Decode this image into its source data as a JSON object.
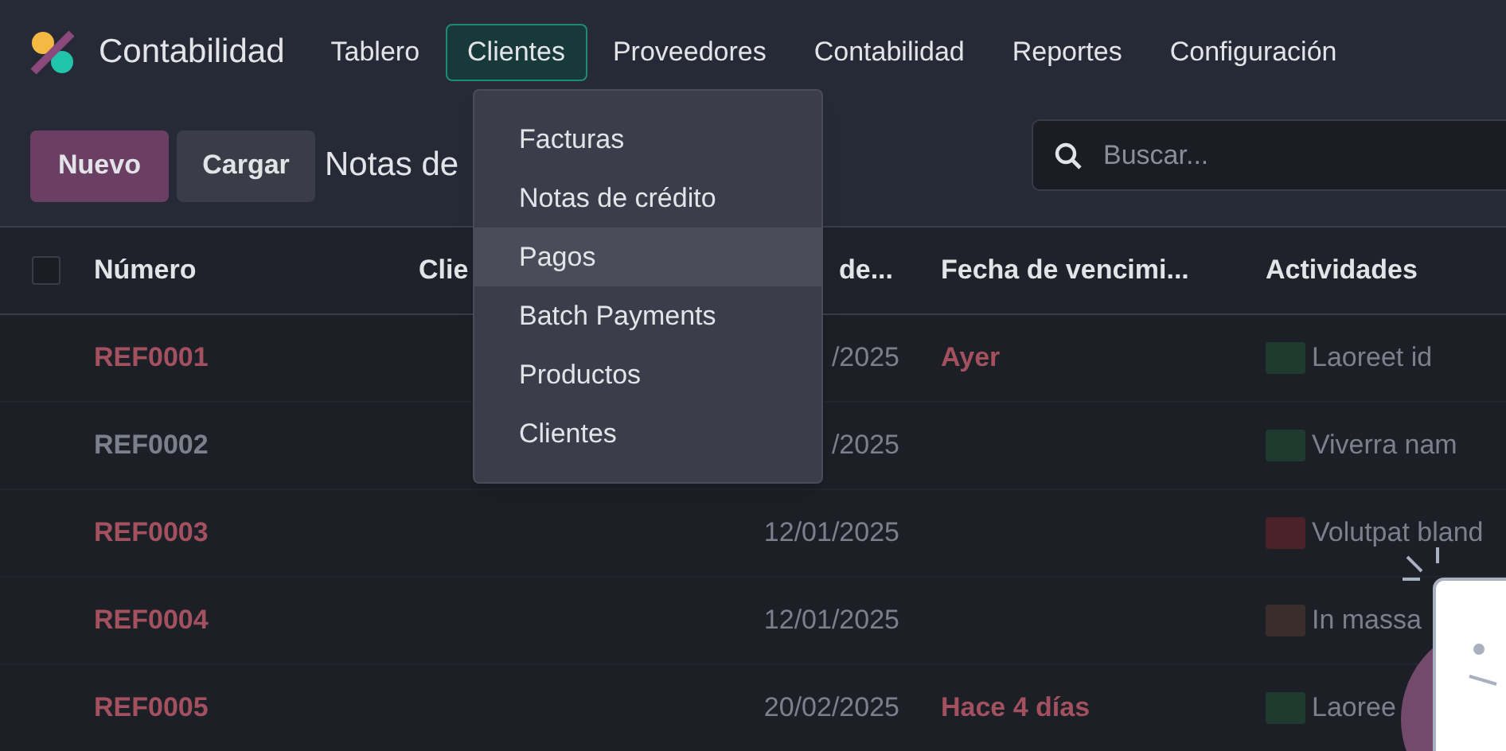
{
  "app": {
    "name": "Contabilidad"
  },
  "nav": [
    {
      "label": "Tablero",
      "selected": false
    },
    {
      "label": "Clientes",
      "selected": true
    },
    {
      "label": "Proveedores",
      "selected": false
    },
    {
      "label": "Contabilidad",
      "selected": false
    },
    {
      "label": "Reportes",
      "selected": false
    },
    {
      "label": "Configuración",
      "selected": false
    }
  ],
  "dropdown": [
    {
      "label": "Facturas",
      "selected": false
    },
    {
      "label": "Notas de crédito",
      "selected": false
    },
    {
      "label": "Pagos",
      "selected": true
    },
    {
      "label": "Batch Payments",
      "selected": false
    },
    {
      "label": "Productos",
      "selected": false
    },
    {
      "label": "Clientes",
      "selected": false
    }
  ],
  "actions": [
    {
      "label": "Nuevo",
      "kind": "primary"
    },
    {
      "label": "Cargar",
      "kind": "secondary"
    }
  ],
  "breadcrumb": "Notas de",
  "search": {
    "placeholder": "Buscar..."
  },
  "table": {
    "select_all": {
      "checked": false
    },
    "columns": [
      "Número",
      "Clie",
      "de...",
      "Fecha de vencimi...",
      "Actividades"
    ],
    "rows": [
      {
        "number": "REF0001",
        "overdue": true,
        "date": "/2025",
        "due": "Ayer",
        "activity": {
          "text": "Laoreet id",
          "color": "#1f3a2e"
        }
      },
      {
        "number": "REF0002",
        "overdue": false,
        "date": "/2025",
        "activity": {
          "text": "Viverra nam",
          "color": "#1f3a2e"
        }
      },
      {
        "number": "REF0003",
        "overdue": true,
        "date": "12/01/2025",
        "activity": {
          "text": "Volutpat bland",
          "color": "#4a2228"
        }
      },
      {
        "number": "REF0004",
        "overdue": true,
        "date": "12/01/2025",
        "activity": {
          "text": "In massa",
          "color": "#3a2e2c"
        }
      },
      {
        "number": "REF0005",
        "overdue": true,
        "date": "20/02/2025",
        "due": "Hace 4 días",
        "activity": {
          "text": "Laoree",
          "color": "#1f3a2e"
        }
      }
    ]
  }
}
